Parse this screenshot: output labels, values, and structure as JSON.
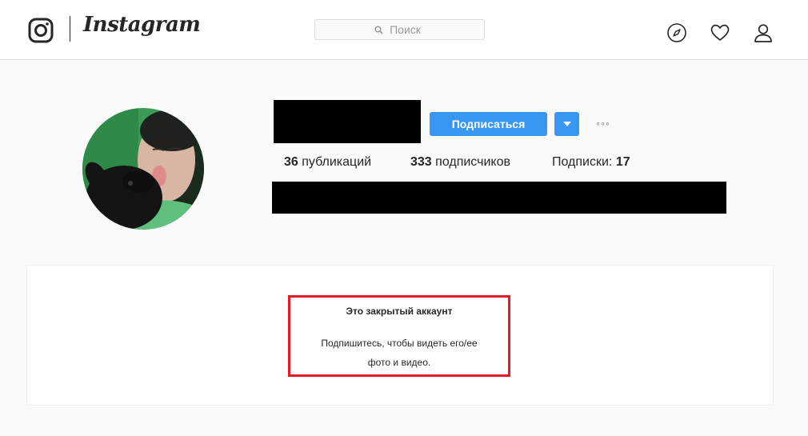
{
  "header": {
    "brand": "Instagram",
    "search_placeholder": "Поиск",
    "icons": [
      "instagram-glyph-icon",
      "search-icon",
      "explore-compass-icon",
      "activity-heart-icon",
      "profile-person-icon"
    ]
  },
  "profile": {
    "follow_label": "Подписаться",
    "dropdown_icon": "caret-down-icon",
    "more_label": "◦◦◦",
    "stats": {
      "posts_count": "36",
      "posts_label": " публикаций",
      "followers_count": "333",
      "followers_label": " подписчиков",
      "following_label": "Подписки: ",
      "following_count": "17"
    }
  },
  "private_notice": {
    "title": "Это закрытый аккаунт",
    "line1": "Подпишитесь, чтобы видеть его/ее",
    "line2": "фото и видео."
  },
  "colors": {
    "accent": "#3897f0",
    "highlight": "#e31b23",
    "text": "#262626",
    "background": "#fafafa"
  }
}
